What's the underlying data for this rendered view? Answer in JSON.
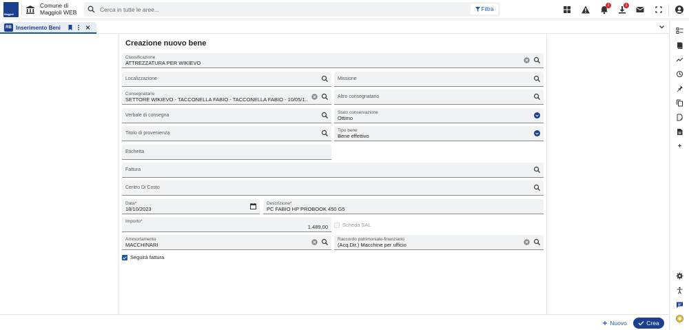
{
  "app": {
    "logo_text": "Maggioli",
    "name": "Comune di Maggioli WEB"
  },
  "search": {
    "placeholder": "Cerca in tutte le aree...",
    "filter_label": "Filtra"
  },
  "notifications": {
    "bell_count": "1",
    "download_count": "1"
  },
  "tab": {
    "label": "Inserimento Beni",
    "icon_text": "RB"
  },
  "form": {
    "title": "Creazione nuovo bene",
    "fields": {
      "classificazione": {
        "label": "Classificazione",
        "value": "ATTREZZATURA PER WIKIEVO"
      },
      "localizzazione": {
        "label": "Localizzazione",
        "value": ""
      },
      "missione": {
        "label": "Missione",
        "value": ""
      },
      "consegnatario": {
        "label": "Consegnatario",
        "value": "SETTORE WIKIEVO - TACCONELLA FABIO - TACCONELLA FABIO - 10/05/1..."
      },
      "altro_consegnatario": {
        "label": "Altro consegnatario",
        "value": ""
      },
      "verbale_consegna": {
        "label": "Verbale di consegna",
        "value": ""
      },
      "stato_conservazione": {
        "label": "Stato conservazione",
        "value": "Ottimo"
      },
      "titolo_provenienza": {
        "label": "Titolo di provenienza",
        "value": ""
      },
      "tipo_bene": {
        "label": "Tipo bene",
        "value": "Bene effettivo"
      },
      "etichetta": {
        "label": "Etichetta",
        "value": ""
      },
      "fattura": {
        "label": "Fattura",
        "value": ""
      },
      "centro_costo": {
        "label": "Centro Di Costo",
        "value": ""
      },
      "data": {
        "label": "Data",
        "value": "18/10/2023"
      },
      "descrizione": {
        "label": "Descrizione",
        "value": "PC FABIO HP PROBOOK 450 G5"
      },
      "importo": {
        "label": "Importo",
        "value": "1.489,00"
      },
      "ammortamento": {
        "label": "Ammortamento",
        "value": "MACCHINARI"
      },
      "raccordo": {
        "label": "Raccordo patrimoniale-finanziario",
        "value": "(Acq.Dir.) Macchine per ufficio"
      }
    },
    "scheda_sal": {
      "label": "Scheda SAL",
      "checked": false
    },
    "seguira_fattura": {
      "label": "Seguirà fattura",
      "checked": true
    },
    "required_mark": "*"
  },
  "actions": {
    "nuovo_label": "Nuovo",
    "crea_label": "Crea"
  },
  "colors": {
    "brand": "#1d3f8f",
    "accent": "#1a56a8",
    "required": "#d62b2b"
  }
}
